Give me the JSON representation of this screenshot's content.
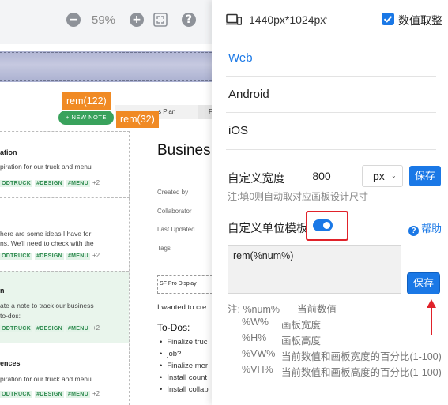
{
  "toolbar": {
    "zoom_out": "−",
    "zoom_level": "59%",
    "zoom_in": "+",
    "fit_icon": "fit-screen-icon",
    "help": "?"
  },
  "canvas": {
    "new_note_label": "+ NEW NOTE",
    "rem_badges": [
      "rem(122)",
      "rem(32)"
    ],
    "tabs": [
      "s Plan",
      "F"
    ],
    "notes": [
      {
        "title": "ation",
        "body": [
          "piration for our truck and menu"
        ],
        "tags": [
          "ODTRUCK",
          "#DESIGN",
          "#MENU"
        ],
        "more": "+2"
      },
      {
        "title": "",
        "body": [
          "here are some ideas I have for",
          "ns. We'll need to check with the"
        ],
        "tags": [
          "ODTRUCK",
          "#DESIGN",
          "#MENU"
        ],
        "more": "+2"
      },
      {
        "title": "n",
        "body": [
          "ate a note to track our business",
          "to-dos:"
        ],
        "tags": [
          "ODTRUCK",
          "#DESIGN",
          "#MENU"
        ],
        "more": "+2"
      },
      {
        "title": "ences",
        "body": [
          "piration for our truck and menu"
        ],
        "tags": [
          "ODTRUCK",
          "#DESIGN",
          "#MENU"
        ],
        "more": "+2"
      }
    ],
    "doc": {
      "title": "Busines",
      "meta": [
        "Created by",
        "Collaborator",
        "Last Updated",
        "Tags"
      ],
      "font_box": "SF Pro Display",
      "intro": "I wanted to cre",
      "todos_heading": "To-Dos:",
      "todo_items": [
        "Finalize truc",
        "job?",
        "Finalize mer",
        "Install count",
        "Install collap"
      ]
    }
  },
  "panel": {
    "device_icon": "device-icon",
    "size_label": "1440px*1024px",
    "size_caret": "^",
    "snap_label": "数值取整",
    "snap_checked": true,
    "platforms": [
      "Web",
      "Android",
      "iOS"
    ],
    "selected_platform": "Web",
    "width": {
      "label": "自定义宽度",
      "value": "800",
      "unit": "px",
      "save_label": "保存",
      "hint": "注:填0则自动取对应画板设计尺寸"
    },
    "template": {
      "label": "自定义单位模板",
      "enabled": true,
      "help_label": "帮助",
      "value": "rem(%num%)",
      "save_label": "保存"
    },
    "notes": [
      {
        "key": "注: %num%",
        "desc": "当前数值"
      },
      {
        "key": "%W%",
        "desc": "画板宽度"
      },
      {
        "key": "%H%",
        "desc": "画板高度"
      },
      {
        "key": "%VW%",
        "desc": "当前数值和画板宽度的百分比(1-100)"
      },
      {
        "key": "%VH%",
        "desc": "当前数值和画板高度的百分比(1-100)"
      }
    ],
    "accent_color": "#1a78e6",
    "highlight_color": "#e0222a"
  }
}
